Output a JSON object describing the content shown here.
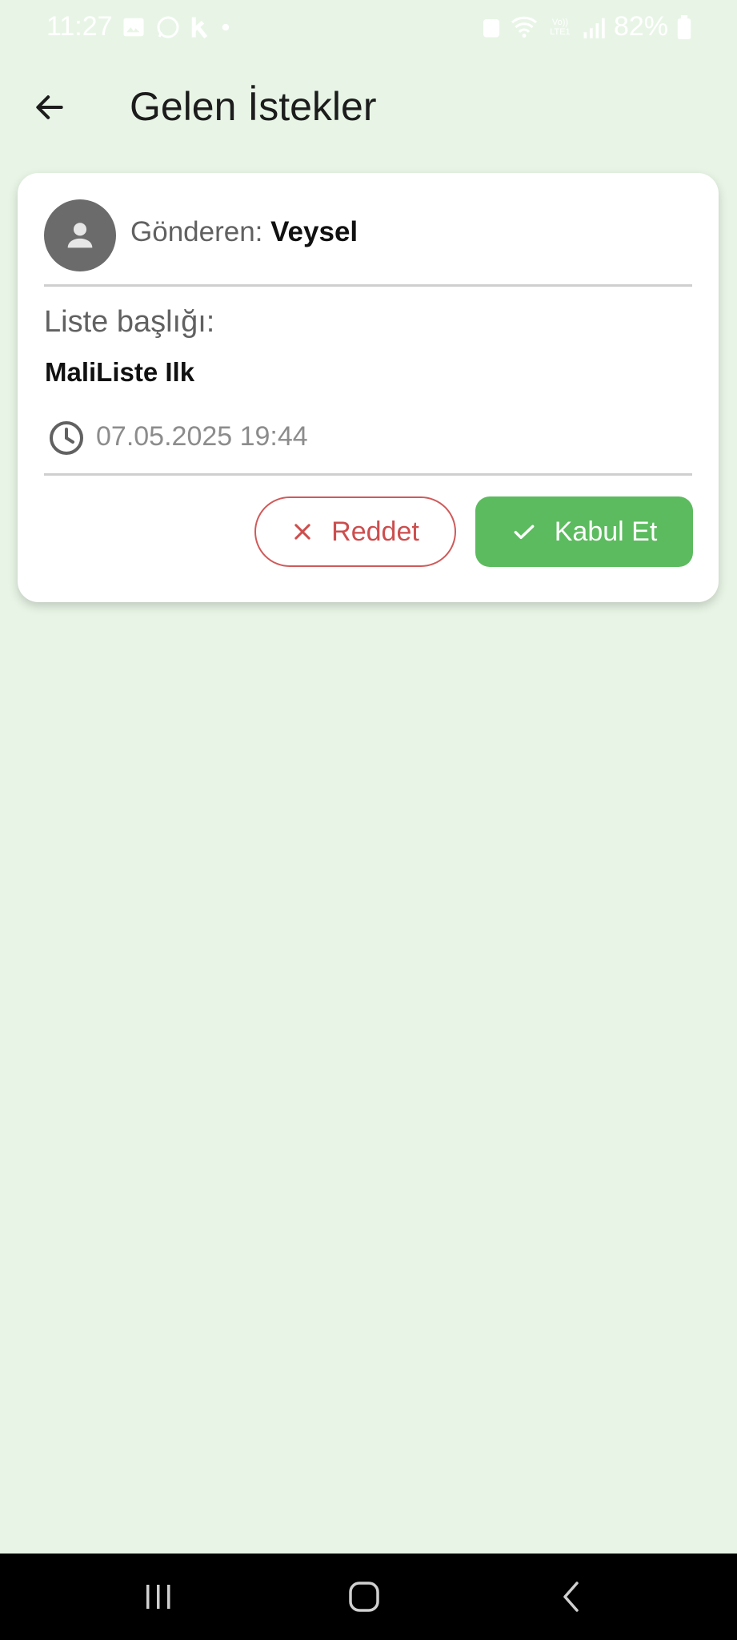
{
  "status_bar": {
    "time": "11:27",
    "battery_percent": "82%",
    "network_label": "LTE1",
    "carrier_label": "Vo))"
  },
  "app_bar": {
    "title": "Gelen İstekler"
  },
  "request": {
    "sender_label": "Gönderen:",
    "sender_name": "Veysel",
    "list_title_label": "Liste başlığı:",
    "list_title": "MaliListe Ilk",
    "timestamp": "07.05.2025 19:44",
    "reject_label": "Reddet",
    "accept_label": "Kabul Et"
  },
  "colors": {
    "background": "#e8f5e6",
    "accept": "#5cbb5e",
    "reject": "#cc4e4e",
    "avatar": "#6b6b6b"
  },
  "icons": [
    "gallery-icon",
    "whatsapp-icon",
    "k-app-icon",
    "dot-icon",
    "wifi-icon",
    "signal-icon",
    "battery-icon",
    "back-arrow-icon",
    "person-icon",
    "clock-icon",
    "close-icon",
    "check-icon",
    "recents-icon",
    "home-icon",
    "nav-back-icon"
  ]
}
